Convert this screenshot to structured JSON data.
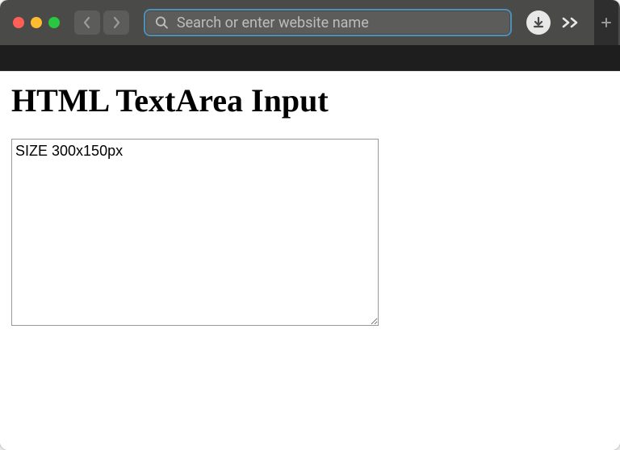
{
  "toolbar": {
    "close_label": "Close",
    "minimize_label": "Minimize",
    "maximize_label": "Maximize",
    "back_label": "Back",
    "forward_label": "Forward",
    "search_placeholder": "Search or enter website name",
    "search_value": "",
    "downloads_label": "Downloads",
    "overflow_label": "More",
    "new_tab_label": "New Tab"
  },
  "page": {
    "heading": "HTML TextArea Input",
    "textarea_value": "SIZE 300x150px"
  }
}
